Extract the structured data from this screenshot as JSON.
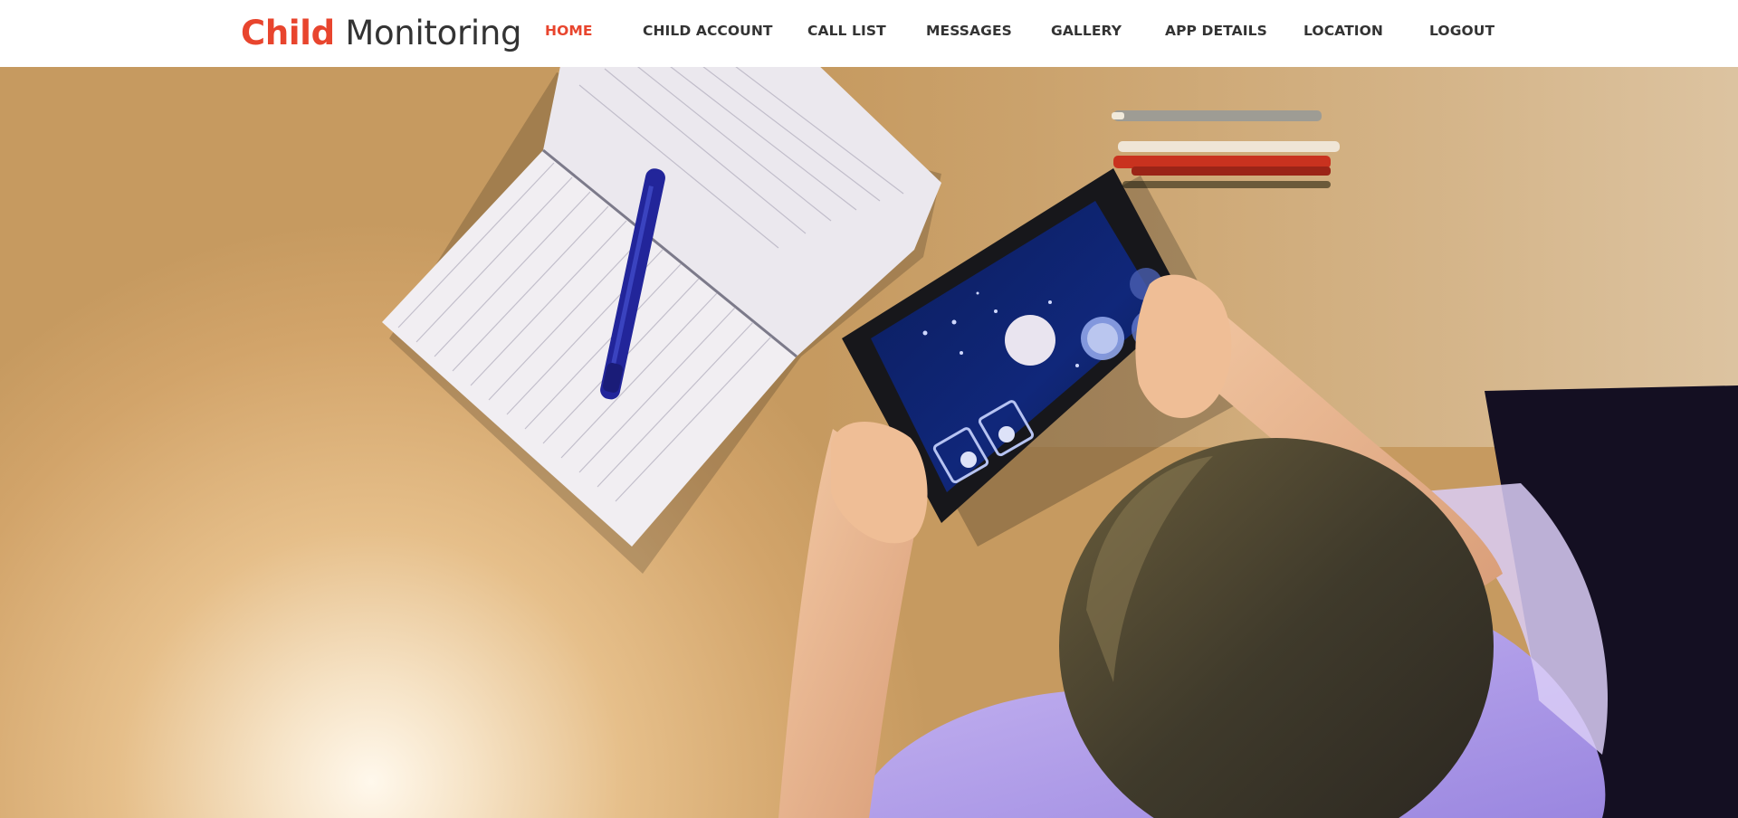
{
  "brand": {
    "accent": "Child",
    "rest": "Monitoring",
    "accent_color": "#e8452e"
  },
  "nav": {
    "items": [
      {
        "label": "HOME",
        "active": true
      },
      {
        "label": "CHILD ACCOUNT",
        "active": false
      },
      {
        "label": "CALL LIST",
        "active": false
      },
      {
        "label": "MESSAGES",
        "active": false
      },
      {
        "label": "GALLERY",
        "active": false
      },
      {
        "label": "APP DETAILS",
        "active": false
      },
      {
        "label": "LOCATION",
        "active": false
      },
      {
        "label": "LOGOUT",
        "active": false
      }
    ]
  },
  "hero": {
    "image": "child-using-tablet-at-desk-photo"
  }
}
